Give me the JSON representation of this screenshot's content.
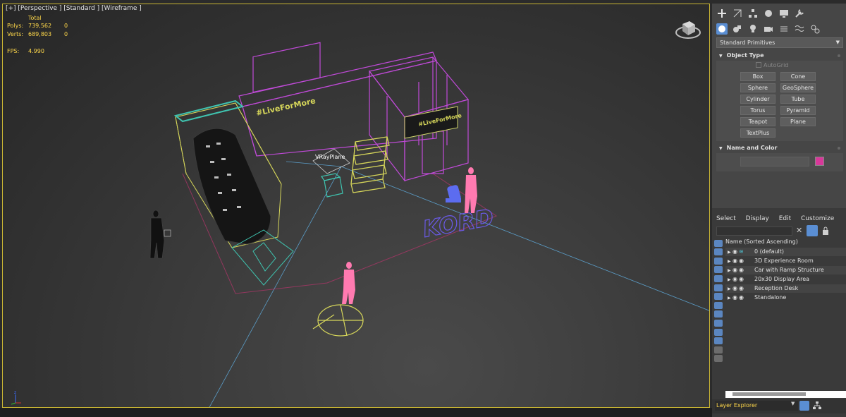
{
  "viewport": {
    "label": "[+] [Perspective ] [Standard ] [Wireframe ]",
    "stats": {
      "total_label": "Total",
      "polys_label": "Polys:",
      "polys_value": "739,562",
      "polys_sel": "0",
      "verts_label": "Verts:",
      "verts_value": "689,803",
      "verts_sel": "0",
      "fps_label": "FPS:",
      "fps_value": "4.990"
    },
    "banner_text": "#LiveForMore",
    "vray_label": "VRayPlane",
    "floor_logo": "KORD",
    "axis_label": "z"
  },
  "command_panel": {
    "toolbar_icons": [
      "create-icon",
      "modify-icon",
      "hierarchy-icon",
      "motion-icon",
      "display-icon",
      "utilities-icon"
    ],
    "category_icons": [
      "geometry-icon",
      "shapes-icon",
      "lights-icon",
      "cameras-icon",
      "helpers-icon",
      "space-warps-icon",
      "systems-icon"
    ],
    "dropdown_value": "Standard Primitives",
    "object_type_title": "Object Type",
    "autogrid_label": "AutoGrid",
    "primitives": [
      "Box",
      "Cone",
      "Sphere",
      "GeoSphere",
      "Cylinder",
      "Tube",
      "Torus",
      "Pyramid",
      "Teapot",
      "Plane",
      "TextPlus"
    ],
    "name_color_title": "Name and Color",
    "color": "#d8389a"
  },
  "scene_explorer": {
    "menu": [
      "Select",
      "Display",
      "Edit",
      "Customize"
    ],
    "header": "Name (Sorted Ascending)",
    "rows": [
      "0 (default)",
      "3D Experience Room",
      "Car with Ramp Structure",
      "20x30 Display Area",
      "Reception Desk",
      "Standalone"
    ],
    "footer_value": "Layer Explorer"
  },
  "colors": {
    "accent": "#5a8ed3",
    "viewport_border": "#c9b533",
    "stats_text": "#ffd84a",
    "wire_magenta": "#c04ad8",
    "wire_yellow": "#d6d65a",
    "wire_cyan": "#3fc4b0",
    "wire_pink": "#ff7ab0",
    "wire_blue": "#6a7fe6"
  }
}
